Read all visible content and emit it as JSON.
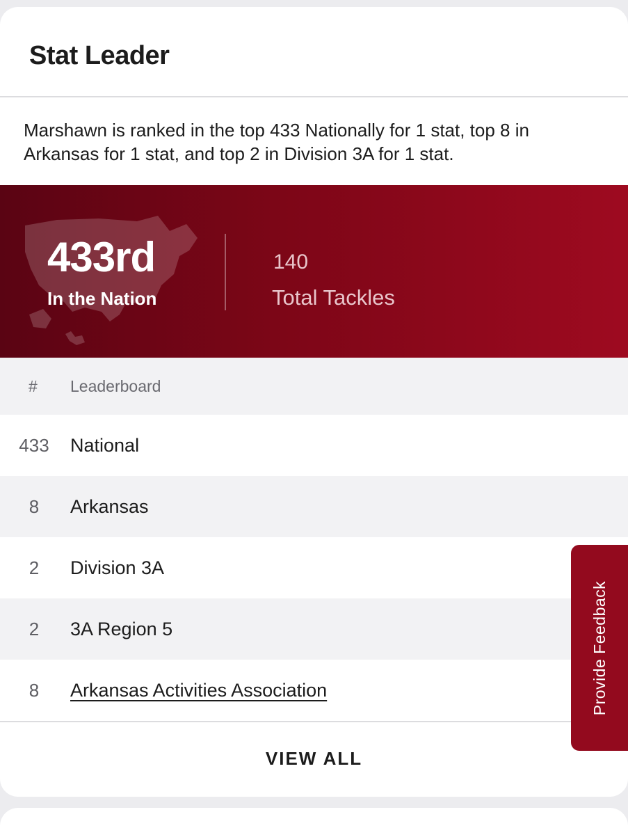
{
  "card": {
    "title": "Stat Leader",
    "summary": "Marshawn is ranked in the top 433 Nationally for 1 stat, top 8 in Arkansas for 1 stat, and top 2 in Division 3A for 1 stat."
  },
  "banner": {
    "rank": "433rd",
    "rank_caption": "In the Nation",
    "stat_value": "140",
    "stat_label": "Total Tackles",
    "icon": "us-map-icon"
  },
  "table": {
    "headers": {
      "num": "#",
      "board": "Leaderboard"
    },
    "rows": [
      {
        "num": "433",
        "board": "National"
      },
      {
        "num": "8",
        "board": "Arkansas"
      },
      {
        "num": "2",
        "board": "Division 3A"
      },
      {
        "num": "2",
        "board": "3A Region 5"
      },
      {
        "num": "8",
        "board": "Arkansas Activities Association"
      }
    ]
  },
  "footer": {
    "view_all": "VIEW ALL"
  },
  "feedback": {
    "label": "Provide Feedback"
  },
  "colors": {
    "brand": "#930a1e",
    "banner_dark": "#5a0413",
    "banner_light": "#9e0a20"
  }
}
